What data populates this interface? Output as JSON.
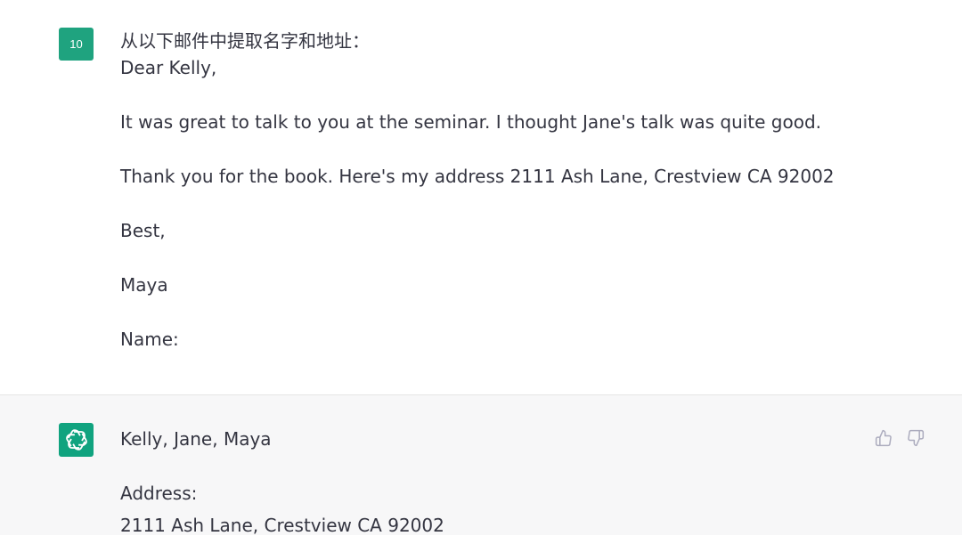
{
  "user_message": {
    "avatar_label": "10",
    "lines": [
      "从以下邮件中提取名字和地址：",
      "Dear Kelly,",
      "It was great to talk to you at the seminar. I thought Jane's talk was quite good.",
      "Thank you for the book. Here's my address 2111 Ash Lane, Crestview CA 92002",
      "Best,",
      "Maya",
      "Name:"
    ]
  },
  "assistant_message": {
    "avatar_icon": "openai-logo-icon",
    "lines": [
      "Kelly, Jane, Maya",
      "Address:",
      "2111 Ash Lane, Crestview CA 92002"
    ]
  },
  "feedback": {
    "like_icon": "thumbs-up-icon",
    "dislike_icon": "thumbs-down-icon"
  },
  "colors": {
    "avatar_user": "#1fa37f",
    "avatar_bot": "#10a37f",
    "assistant_bg": "#f7f7f8",
    "text": "#343541",
    "icon": "#acacbe"
  }
}
